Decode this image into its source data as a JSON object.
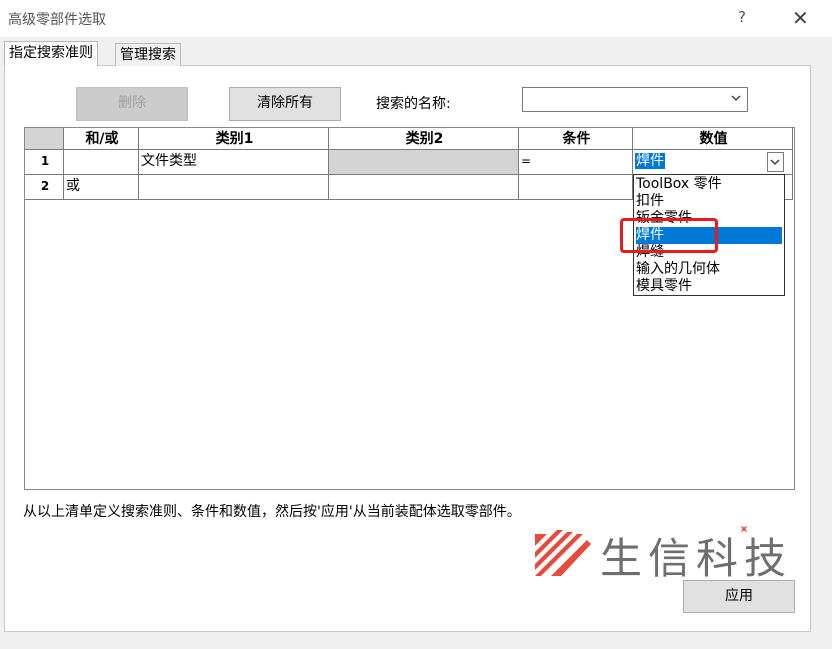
{
  "window": {
    "title": "高级零部件选取",
    "help": "?",
    "close": "✕"
  },
  "tabs": [
    "指定搜索准则",
    "管理搜索"
  ],
  "toolbar": {
    "delete_label": "删除",
    "clear_label": "清除所有",
    "search_name_label": "搜索的名称:",
    "search_name_value": ""
  },
  "table": {
    "headers": [
      "和/或",
      "类别1",
      "类别2",
      "条件",
      "数值"
    ],
    "rows": [
      {
        "num": "1",
        "andor": "",
        "cat1": "文件类型",
        "cat2": "",
        "cond": "=",
        "value": "焊件"
      },
      {
        "num": "2",
        "andor": "或",
        "cat1": "",
        "cat2": "",
        "cond": "",
        "value": ""
      }
    ]
  },
  "dropdown": {
    "options": [
      "ToolBox 零件",
      "扣件",
      "钣金零件",
      "焊件",
      "焊缝",
      "输入的几何体",
      "模具零件"
    ],
    "selected": "焊件"
  },
  "instruction": "从以上清单定义搜索准则、条件和数值，然后按'应用'从当前装配体选取零部件。",
  "watermark": "生信科技",
  "apply_label": "应用",
  "colors": {
    "selection": "#0078d7",
    "highlight_box": "#e81c1c",
    "logo_red": "#e84a3c"
  }
}
